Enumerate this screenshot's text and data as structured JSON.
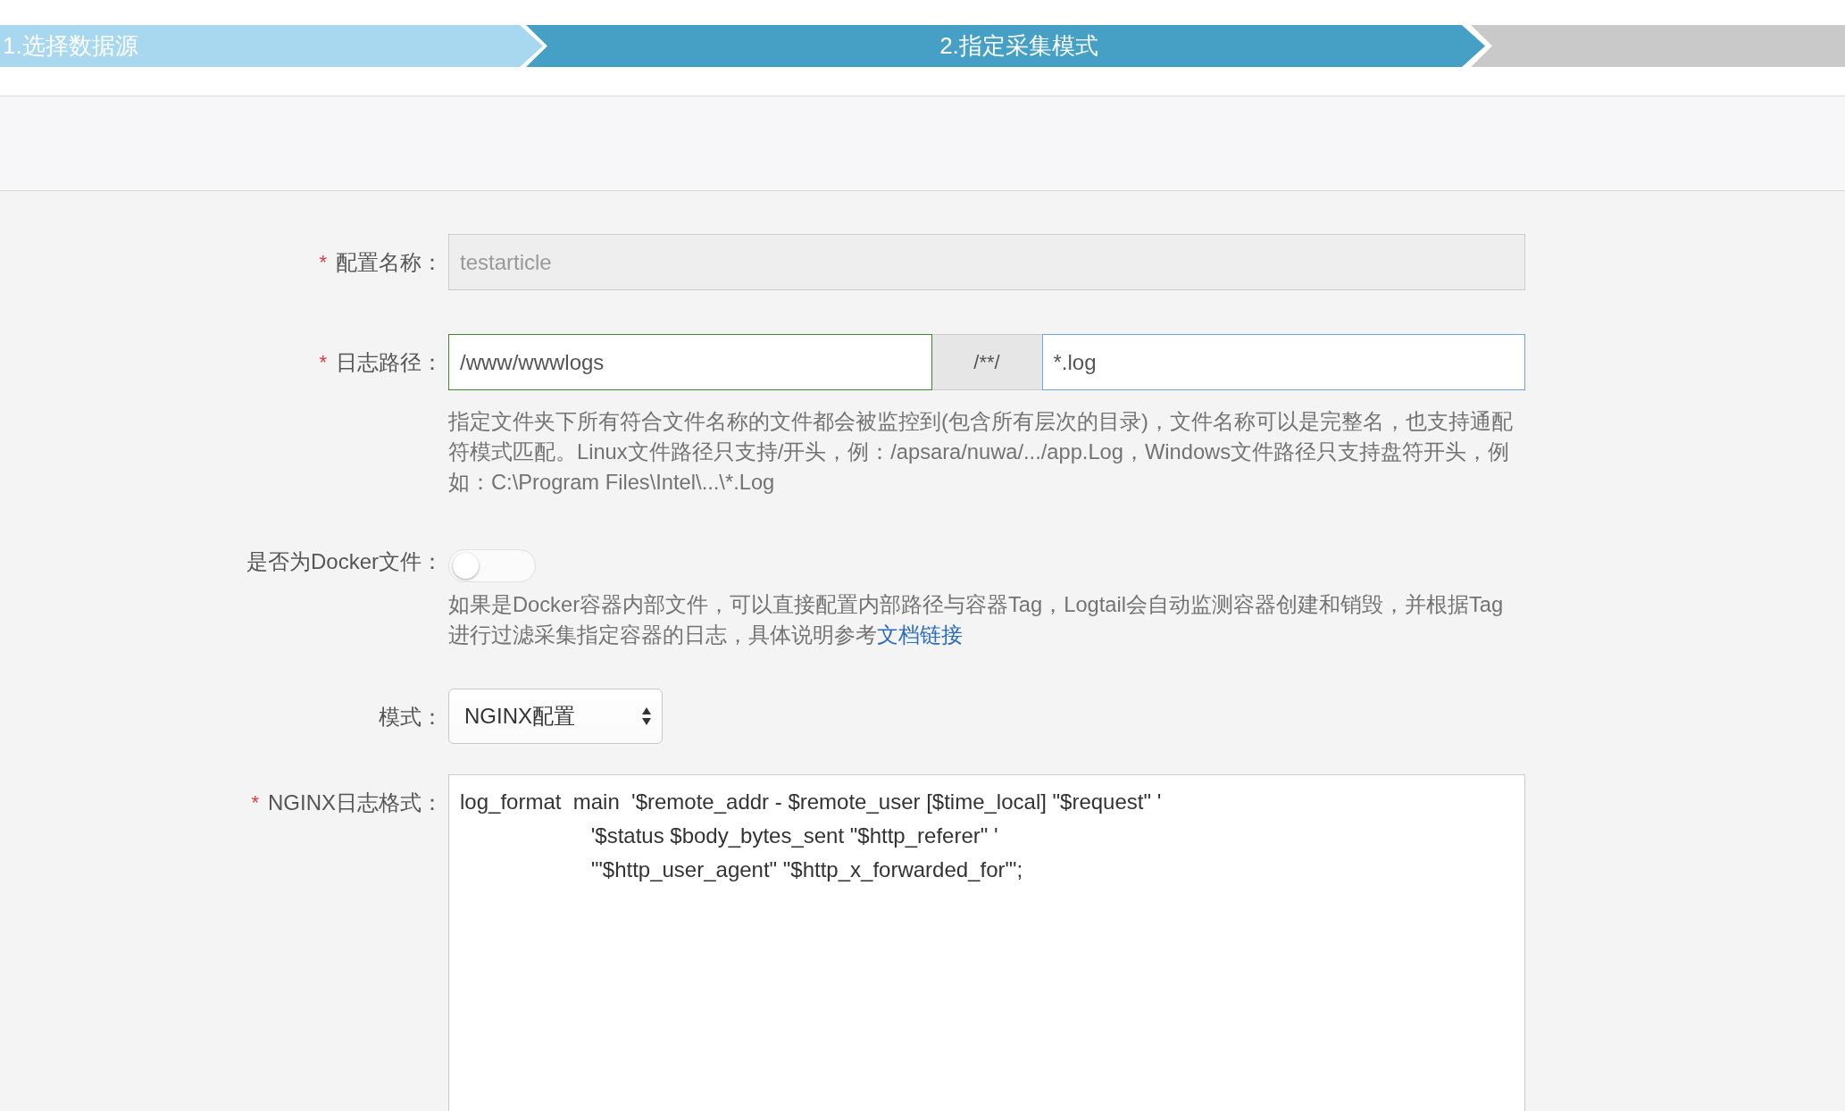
{
  "steps": [
    {
      "label": "1.选择数据源",
      "completed": true,
      "current": false
    },
    {
      "label": "2.指定采集模式",
      "completed": false,
      "current": true
    },
    {
      "completed": false,
      "current": false
    }
  ],
  "form": {
    "config_name": {
      "required_mark": "*",
      "label": "配置名称：",
      "value": "testarticle",
      "disabled": true
    },
    "log_path": {
      "required_mark": "*",
      "label": "日志路径：",
      "directory": {
        "value": "/www/wwwlogs",
        "validated": true
      },
      "separator": "/**/",
      "file_pattern": {
        "value": "*.log",
        "focused": true
      },
      "help": "指定文件夹下所有符合文件名称的文件都会被监控到(包含所有层次的目录)，文件名称可以是完整名，也支持通配符模式匹配。Linux文件路径只支持/开头，例：/apsara/nuwa/.../app.Log，Windows文件路径只支持盘符开头，例如：C:\\Program Files\\Intel\\...\\*.Log"
    },
    "docker": {
      "label": "是否为Docker文件：",
      "on": false,
      "help": "如果是Docker容器内部文件，可以直接配置内部路径与容器Tag，Logtail会自动监测容器创建和销毁，并根据Tag进行过滤采集指定容器的日志，具体说明参考",
      "help_link": "文档链接"
    },
    "mode": {
      "label": "模式：",
      "value": "NGINX配置"
    },
    "nginx_format": {
      "required_mark": "*",
      "label": "NGINX日志格式：",
      "value": "log_format  main  '$remote_addr - $remote_user [$time_local] \"$request\" '\n                      '$status $body_bytes_sent \"$http_referer\" '\n                      '\"$http_user_agent\" \"$http_x_forwarded_for\"';"
    }
  }
}
